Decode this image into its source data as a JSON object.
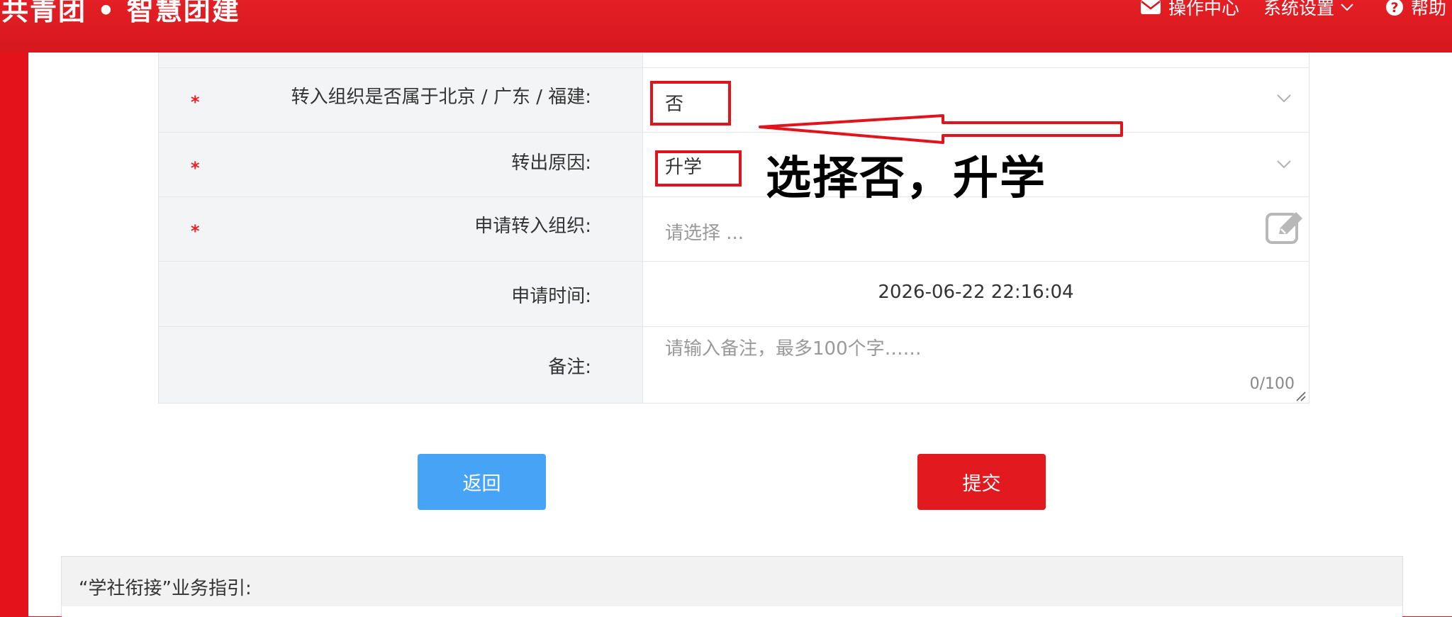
{
  "header": {
    "brand": "共青团 • 智慧团建",
    "nav": {
      "ops_center": "操作中心",
      "settings": "系统设置",
      "help": "帮助"
    }
  },
  "form": {
    "fields": {
      "beijing": {
        "label": "转入组织是否属于北京 / 广东 / 福建:",
        "value": "否",
        "required": "*"
      },
      "reason": {
        "label": "转出原因:",
        "value": "升学",
        "required": "*"
      },
      "org": {
        "label": "申请转入组织:",
        "placeholder": "请选择 ...",
        "required": "*"
      },
      "time": {
        "label": "申请时间:",
        "value": "2026-06-22 22:16:04"
      },
      "remark": {
        "label": "备注:",
        "placeholder": "请输入备注，最多100个字……",
        "counter": "0/100"
      }
    }
  },
  "actions": {
    "back": "返回",
    "submit": "提交"
  },
  "guide": {
    "title": "“学社衔接”业务指引:"
  },
  "annotation": {
    "text": "选择否，升学",
    "color": "#e0141c"
  },
  "colors": {
    "brand_red": "#e21a20",
    "back_blue": "#47a3f5"
  }
}
